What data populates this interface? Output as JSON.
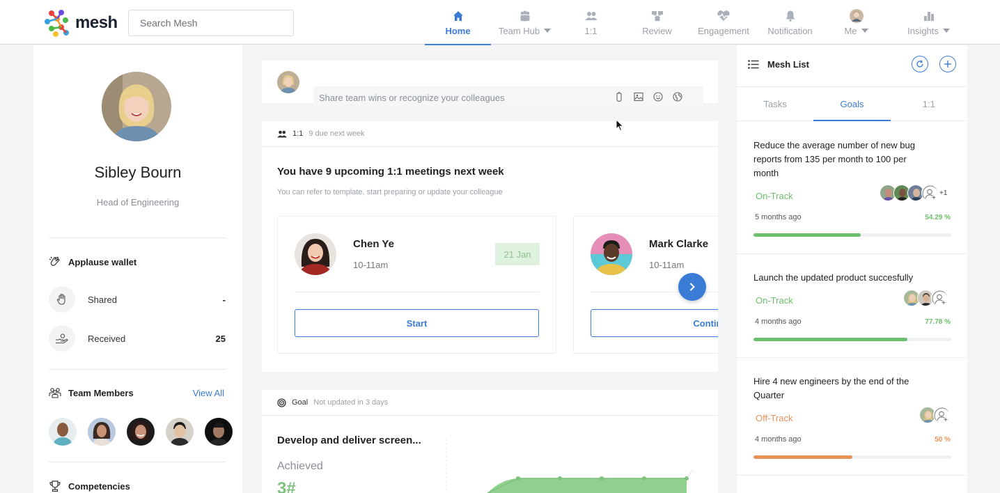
{
  "app": {
    "logo_text": "mesh"
  },
  "search": {
    "placeholder": "Search Mesh"
  },
  "nav": {
    "home": "Home",
    "team_hub": "Team Hub",
    "one_on_one": "1:1",
    "review": "Review",
    "engagement": "Engagement",
    "notification": "Notification",
    "me": "Me",
    "insights": "Insights"
  },
  "profile": {
    "name": "Sibley Bourn",
    "role": "Head of Engineering"
  },
  "applause": {
    "title": "Applause wallet",
    "shared_label": "Shared",
    "shared_value": "-",
    "received_label": "Received",
    "received_value": "25"
  },
  "team": {
    "title": "Team Members",
    "view_all": "View All"
  },
  "competencies": {
    "title": "Competencies"
  },
  "post": {
    "placeholder": "Share team wins or recognize your colleagues"
  },
  "meetings": {
    "tag": "1:1",
    "due": "9 due next week",
    "title": "You have 9 upcoming 1:1 meetings next week",
    "subtitle": "You can refer to template, start preparing or update your colleague",
    "items": [
      {
        "name": "Chen Ye",
        "time": "10-11am",
        "date": "21 Jan",
        "button": "Start"
      },
      {
        "name": "Mark Clarke",
        "time": "10-11am",
        "button": "Continue"
      }
    ]
  },
  "goal_card": {
    "tag": "Goal",
    "updated": "Not updated in 3 days",
    "title": "Develop and deliver screen...",
    "achieved_label": "Achieved",
    "achieved_value": "3#"
  },
  "mesh_list": {
    "title": "Mesh List",
    "tabs": [
      "Tasks",
      "Goals",
      "1:1"
    ],
    "goals": [
      {
        "title": "Reduce the average number of new bug reports from 135 per month to 100 per month",
        "status": "On-Track",
        "ago": "5 months ago",
        "percent_label": "54.29 %",
        "progress": 54.29,
        "extra": "+1"
      },
      {
        "title": "Launch the updated product succesfully",
        "status": "On-Track",
        "ago": "4 months ago",
        "percent_label": "77.78 %",
        "progress": 77.78
      },
      {
        "title": "Hire 4 new engineers by the end of the Quarter",
        "status": "Off-Track",
        "ago": "4 months ago",
        "percent_label": "50 %",
        "progress": 50
      }
    ]
  },
  "colors": {
    "accent": "#3a7bd5",
    "on_track": "#6cbf6c",
    "off_track": "#e8925a"
  }
}
